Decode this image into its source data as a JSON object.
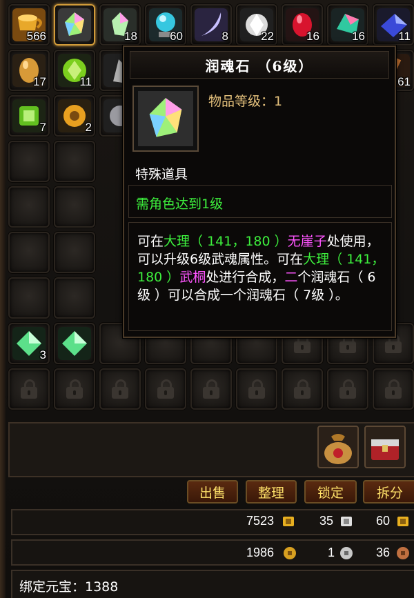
{
  "colors": {
    "accent": "#d19b3a",
    "green_text": "#3df03d",
    "pink_text": "#ff55ff",
    "gold_text": "#e6c27d",
    "button_text": "#ffe26a"
  },
  "inventory": {
    "row1": [
      {
        "name": "gold-cup-item-icon",
        "qty": "566"
      },
      {
        "name": "runhun-stone-item-icon",
        "qty": ""
      },
      {
        "name": "crystal-shard-item-icon",
        "qty": "18"
      },
      {
        "name": "blue-orb-item-icon",
        "qty": "60"
      },
      {
        "name": "crescent-gem-item-icon",
        "qty": "8"
      },
      {
        "name": "diamond-item-icon",
        "qty": "22"
      },
      {
        "name": "red-gem-item-icon",
        "qty": "16"
      },
      {
        "name": "teal-crystal-item-icon",
        "qty": "16"
      },
      {
        "name": "blue-crystal-item-icon",
        "qty": "11"
      }
    ],
    "row2": [
      {
        "name": "gold-egg-item-icon",
        "qty": "17"
      },
      {
        "name": "green-gem-item-icon",
        "qty": "11"
      },
      {
        "name": "silver-shard-item-icon",
        "qty": ""
      },
      {
        "name": "hidden-slot",
        "qty": ""
      },
      {
        "name": "hidden-slot",
        "qty": ""
      },
      {
        "name": "hidden-slot",
        "qty": ""
      },
      {
        "name": "hidden-slot",
        "qty": ""
      },
      {
        "name": "hidden-slot",
        "qty": ""
      },
      {
        "name": "gold-item-icon",
        "qty": "61"
      }
    ],
    "row3": [
      {
        "name": "green-square-gem-item-icon",
        "qty": "7"
      },
      {
        "name": "amber-ring-item-icon",
        "qty": "2"
      },
      {
        "name": "silver-gem-item-icon",
        "qty": ""
      }
    ],
    "row7": [
      {
        "name": "green-crystal-item-icon",
        "qty": "3"
      },
      {
        "name": "green-crystal-item-icon",
        "qty": ""
      }
    ]
  },
  "tooltip": {
    "title": "润魂石 （6级）",
    "item_level": "物品等级：1",
    "item_type": "特殊道具",
    "requirement": "需角色达到1级",
    "desc": {
      "a1": "可在",
      "g1": "大理（ 141，180 ）",
      "p1": "无崖子",
      "a2": "处使用，可以升级6级武魂属性。可在",
      "g2": "大理（ 141，180 ）",
      "p2": "武桐",
      "a3": "处进行合成，",
      "g3": "二",
      "a4": "个润魂石（ 6级 ）可以合成一个润魂石（ 7级 ）。"
    }
  },
  "buttons": {
    "sell": "出售",
    "sort": "整理",
    "lock": "锁定",
    "split": "拆分"
  },
  "money": {
    "yuanbao": "7523",
    "yuanbao_bound": "35",
    "yuanbao_other": "60",
    "gold": "1986",
    "silver": "1",
    "copper": "36"
  },
  "bound_yuanbao": "绑定元宝：1388"
}
